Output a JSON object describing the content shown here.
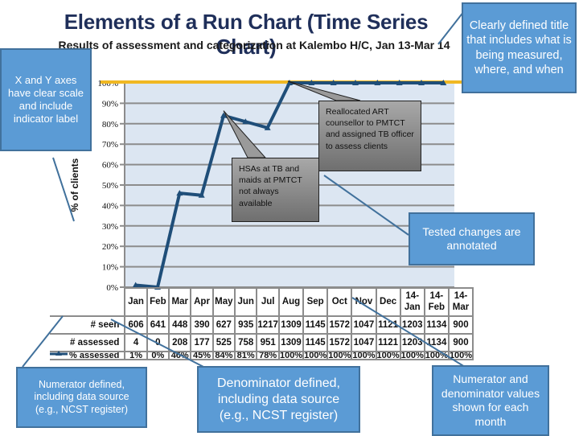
{
  "header": {
    "title": "Elements of a Run Chart (Time Series Chart)",
    "subtitle": "Results of assessment and categorization at Kalembo H/C, Jan 13-Mar 14"
  },
  "colors": {
    "line": "#1f4e79",
    "goal_line": "#f0b823",
    "plot_bg": "#dce6f2",
    "callout_bg": "#5b9bd5",
    "callout_border": "#41719c",
    "grid": "#8c8c8c"
  },
  "callouts": {
    "title_note": "Clearly defined title that includes what is being measured, where, and when",
    "axes_note": "X and Y axes have clear scale and include indicator label",
    "annotated_note": "Tested changes are annotated",
    "numerator_note": "Numerator defined, including data source (e.g., NCST register)",
    "denominator_note": "Denominator defined, including data source (e.g., NCST register)",
    "values_note": "Numerator and denominator values shown for each month"
  },
  "annotations": {
    "hsas_note": "HSAs at TB and maids at PMTCT not always available",
    "realloc_note": "Reallocated ART counsellor to PMTCT and assigned TB officer to assess clients"
  },
  "chart_data": {
    "type": "line",
    "title": "Elements of a Run Chart (Time Series Chart)",
    "subtitle": "Results of assessment and categorization at Kalembo H/C, Jan 13-Mar 14",
    "xlabel": "",
    "ylabel": "% of clients",
    "ylim": [
      0,
      100
    ],
    "y_ticks": [
      "0%",
      "10%",
      "20%",
      "30%",
      "40%",
      "50%",
      "60%",
      "70%",
      "80%",
      "90%",
      "100%"
    ],
    "grid": true,
    "goal_line": 100,
    "categories": [
      "Jan",
      "Feb",
      "Mar",
      "Apr",
      "May",
      "Jun",
      "Jul",
      "Aug",
      "Sep",
      "Oct",
      "Nov",
      "Dec",
      "14-Jan",
      "14-Feb",
      "14-Mar"
    ],
    "series": [
      {
        "name": "% assessed",
        "values": [
          1,
          0,
          46,
          45,
          84,
          81,
          78,
          100,
          100,
          100,
          100,
          100,
          100,
          100,
          100
        ]
      }
    ],
    "table": {
      "rows": [
        {
          "label": "# seen",
          "values": [
            "606",
            "641",
            "448",
            "390",
            "627",
            "935",
            "1217",
            "1309",
            "1145",
            "1572",
            "1047",
            "1121",
            "1203",
            "1134",
            "900"
          ]
        },
        {
          "label": "# assessed",
          "values": [
            "4",
            "0",
            "208",
            "177",
            "525",
            "758",
            "951",
            "1309",
            "1145",
            "1572",
            "1047",
            "1121",
            "1203",
            "1134",
            "900"
          ]
        },
        {
          "label": "% assessed",
          "values": [
            "1%",
            "0%",
            "46%",
            "45%",
            "84%",
            "81%",
            "78%",
            "100%",
            "100%",
            "100%",
            "100%",
            "100%",
            "100%",
            "100%",
            "100%"
          ]
        }
      ]
    },
    "annotations": [
      {
        "at": "May",
        "text": "HSAs at TB and maids at PMTCT not always available"
      },
      {
        "at": "Aug",
        "text": "Reallocated ART counsellor to PMTCT and assigned TB officer to assess clients"
      }
    ]
  }
}
